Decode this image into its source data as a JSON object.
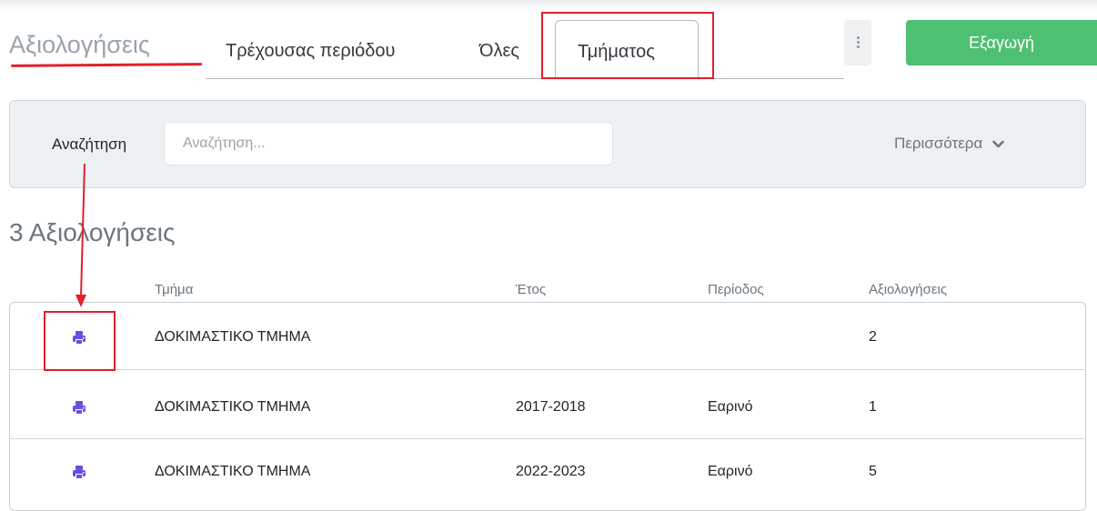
{
  "header": {
    "title": "Αξιολογήσεις",
    "tabs": [
      {
        "label": "Τρέχουσας περιόδου"
      },
      {
        "label": "Όλες"
      },
      {
        "label": "Τμήματος"
      }
    ],
    "export_label": "Εξαγωγή"
  },
  "search": {
    "label": "Αναζήτηση",
    "placeholder": "Αναζήτηση...",
    "more_label": "Περισσότερα"
  },
  "results": {
    "count_title": "3 Αξιολογήσεις",
    "columns": [
      "Τμήμα",
      "Έτος",
      "Περίοδος",
      "Αξιολογήσεις"
    ],
    "rows": [
      {
        "department": "ΔΟΚΙΜΑΣΤΙΚΟ ΤΜΗΜΑ",
        "year": "",
        "period": "",
        "evaluations": "2"
      },
      {
        "department": "ΔΟΚΙΜΑΣΤΙΚΟ ΤΜΗΜΑ",
        "year": "2017-2018",
        "period": "Εαρινό",
        "evaluations": "1"
      },
      {
        "department": "ΔΟΚΙΜΑΣΤΙΚΟ ΤΜΗΜΑ",
        "year": "2022-2023",
        "period": "Εαρινό",
        "evaluations": "5"
      }
    ]
  },
  "icons": {
    "row_action": "printer-icon",
    "menu": "kebab-icon",
    "more": "chevron-down-icon"
  },
  "colors": {
    "accent": "#6c4de0",
    "export": "#4fbf73",
    "annotation": "#e0202a"
  }
}
